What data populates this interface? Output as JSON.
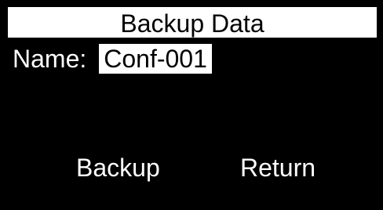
{
  "screen": {
    "title": "Backup Data",
    "name_label": "Name:",
    "name_value": "Conf-001",
    "softkeys": {
      "left": "Backup",
      "right": "Return"
    }
  },
  "colors": {
    "background": "#000000",
    "foreground": "#ffffff",
    "inverse_text": "#000000"
  }
}
